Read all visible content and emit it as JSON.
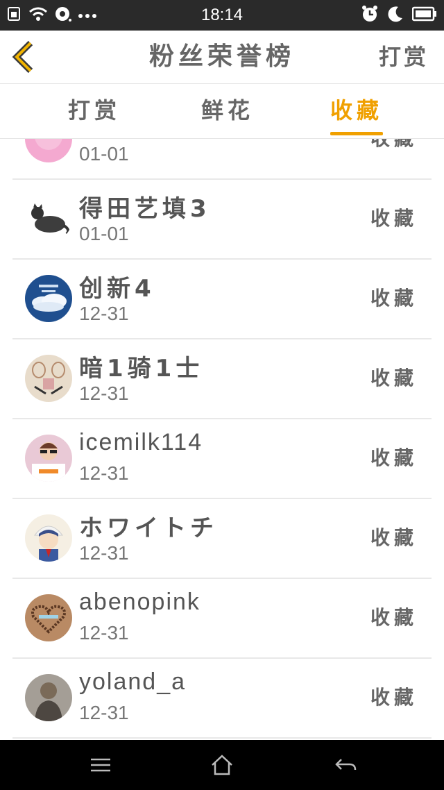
{
  "status_bar": {
    "time": "18:14",
    "icons_left": [
      "sim-icon",
      "wifi-icon",
      "record-icon",
      "more-icon"
    ],
    "icons_right": [
      "alarm-icon",
      "moon-icon",
      "battery-icon"
    ]
  },
  "header": {
    "title": "粉丝荣誉榜",
    "action_label": "打赏"
  },
  "tabs": [
    {
      "label": "打赏",
      "active": false
    },
    {
      "label": "鲜花",
      "active": false
    },
    {
      "label": "收藏",
      "active": true
    }
  ],
  "list": {
    "rows": [
      {
        "name": "",
        "date": "01-01",
        "type": "收藏",
        "avatar": "pink-circle"
      },
      {
        "name": "得田艺填3",
        "date": "01-01",
        "type": "收藏",
        "avatar": "cat"
      },
      {
        "name": "创新4",
        "date": "12-31",
        "type": "收藏",
        "avatar": "sky-clouds"
      },
      {
        "name": "暗1骑1士",
        "date": "12-31",
        "type": "收藏",
        "avatar": "tennis"
      },
      {
        "name": "icemilk114",
        "date": "12-31",
        "type": "收藏",
        "avatar": "person-trunk"
      },
      {
        "name": "ホワイトチ",
        "date": "12-31",
        "type": "收藏",
        "avatar": "anime-boy"
      },
      {
        "name": "abenopink",
        "date": "12-31",
        "type": "收藏",
        "avatar": "heart-frame"
      },
      {
        "name": "yoland_a",
        "date": "12-31",
        "type": "收藏",
        "avatar": "grey-person"
      }
    ]
  },
  "nav_bar": {
    "buttons": [
      "menu-icon",
      "home-icon",
      "back-arrow-icon"
    ]
  },
  "colors": {
    "accent": "#f0a000",
    "status_bar": "#2a2a2a",
    "text": "#555555",
    "divider": "#e8e8e8"
  }
}
